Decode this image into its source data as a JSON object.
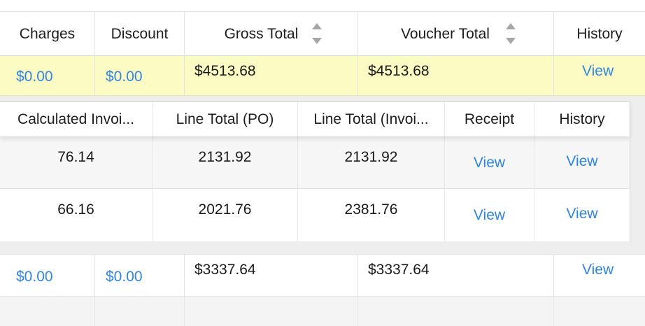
{
  "outer_table": {
    "columns": [
      "Charges",
      "Discount",
      "Gross Total",
      "Voucher Total",
      "History"
    ],
    "rows": [
      {
        "charges": "$0.00",
        "discount": "$0.00",
        "gross_total": "$4513.68",
        "voucher_total": "$4513.68",
        "history": "View"
      },
      {
        "charges": "$0.00",
        "discount": "$0.00",
        "gross_total": "$3337.64",
        "voucher_total": "$3337.64",
        "history": "View"
      }
    ]
  },
  "inner_table": {
    "columns": [
      "Calculated Invoi...",
      "Line Total (PO)",
      "Line Total (Invoi...",
      "Receipt",
      "History"
    ],
    "rows": [
      {
        "calculated": "76.14",
        "line_total_po": "2131.92",
        "line_total_invoice": "2131.92",
        "receipt": "View",
        "history": "View"
      },
      {
        "calculated": "66.16",
        "line_total_po": "2021.76",
        "line_total_invoice": "2381.76",
        "receipt": "View",
        "history": "View"
      }
    ]
  },
  "colors": {
    "link": "#2f86e0",
    "selected_row": "#fdfbc4",
    "expand_bg": "#eeeeee",
    "sort_icon": "#a6a6a6"
  }
}
